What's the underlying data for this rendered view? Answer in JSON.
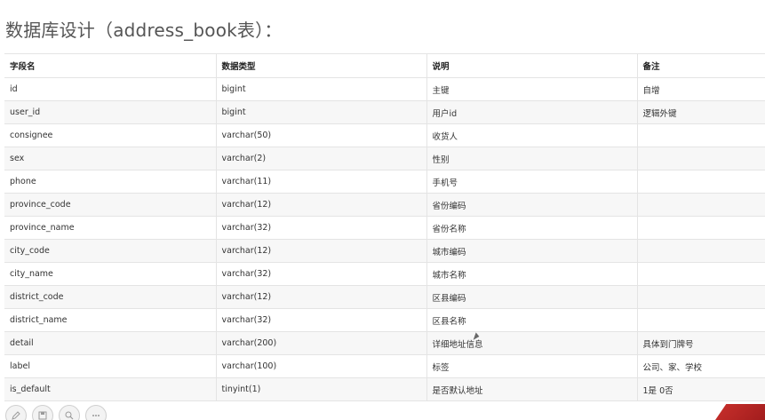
{
  "title": "数据库设计（address_book表）：",
  "table": {
    "headers": [
      "字段名",
      "数据类型",
      "说明",
      "备注"
    ],
    "rows": [
      [
        "id",
        "bigint",
        "主键",
        "自增"
      ],
      [
        "user_id",
        "bigint",
        "用户id",
        "逻辑外键"
      ],
      [
        "consignee",
        "varchar(50)",
        "收货人",
        ""
      ],
      [
        "sex",
        "varchar(2)",
        "性别",
        ""
      ],
      [
        "phone",
        "varchar(11)",
        "手机号",
        ""
      ],
      [
        "province_code",
        "varchar(12)",
        "省份编码",
        ""
      ],
      [
        "province_name",
        "varchar(32)",
        "省份名称",
        ""
      ],
      [
        "city_code",
        "varchar(12)",
        "城市编码",
        ""
      ],
      [
        "city_name",
        "varchar(32)",
        "城市名称",
        ""
      ],
      [
        "district_code",
        "varchar(12)",
        "区县编码",
        ""
      ],
      [
        "district_name",
        "varchar(32)",
        "区县名称",
        ""
      ],
      [
        "detail",
        "varchar(200)",
        "详细地址信息",
        "具体到门牌号"
      ],
      [
        "label",
        "varchar(100)",
        "标签",
        "公司、家、学校"
      ],
      [
        "is_default",
        "tinyint(1)",
        "是否默认地址",
        "1是 0否"
      ]
    ]
  },
  "toolbar": {
    "icons": [
      "pen-icon",
      "save-icon",
      "zoom-icon",
      "menu-icon"
    ]
  }
}
